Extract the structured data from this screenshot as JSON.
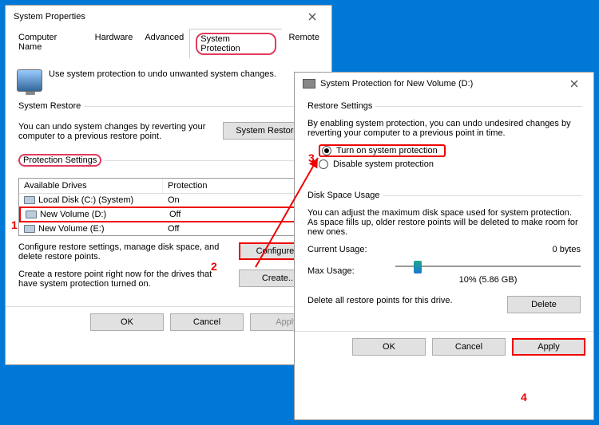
{
  "win1": {
    "title": "System Properties",
    "tabs": [
      "Computer Name",
      "Hardware",
      "Advanced",
      "System Protection",
      "Remote"
    ],
    "active_tab": 3,
    "desc": "Use system protection to undo unwanted system changes.",
    "restore": {
      "legend": "System Restore",
      "text": "You can undo system changes by reverting your computer to a previous restore point.",
      "btn": "System Restore..."
    },
    "protset": {
      "legend": "Protection Settings",
      "col1": "Available Drives",
      "col2": "Protection",
      "drives": [
        {
          "name": "Local Disk (C:) (System)",
          "prot": "On"
        },
        {
          "name": "New Volume (D:)",
          "prot": "Off"
        },
        {
          "name": "New Volume (E:)",
          "prot": "Off"
        }
      ],
      "configure_text": "Configure restore settings, manage disk space, and delete restore points.",
      "configure_btn": "Configure...",
      "create_text": "Create a restore point right now for the drives that have system protection turned on.",
      "create_btn": "Create..."
    },
    "footer": {
      "ok": "OK",
      "cancel": "Cancel",
      "apply": "Apply"
    }
  },
  "win2": {
    "title": "System Protection for New Volume (D:)",
    "restore": {
      "legend": "Restore Settings",
      "text": "By enabling system protection, you can undo undesired changes by reverting your computer to a previous point in time.",
      "opt_on": "Turn on system protection",
      "opt_off": "Disable system protection",
      "selected": "on"
    },
    "disk": {
      "legend": "Disk Space Usage",
      "text": "You can adjust the maximum disk space used for system protection. As space fills up, older restore points will be deleted to make room for new ones.",
      "cur_label": "Current Usage:",
      "cur_val": "0 bytes",
      "max_label": "Max Usage:",
      "slider_pct": 10,
      "slider_text": "10% (5.86 GB)",
      "delete_text": "Delete all restore points for this drive.",
      "delete_btn": "Delete"
    },
    "footer": {
      "ok": "OK",
      "cancel": "Cancel",
      "apply": "Apply"
    }
  },
  "annot": {
    "n1": "1",
    "n2": "2",
    "n3": "3",
    "n4": "4"
  }
}
